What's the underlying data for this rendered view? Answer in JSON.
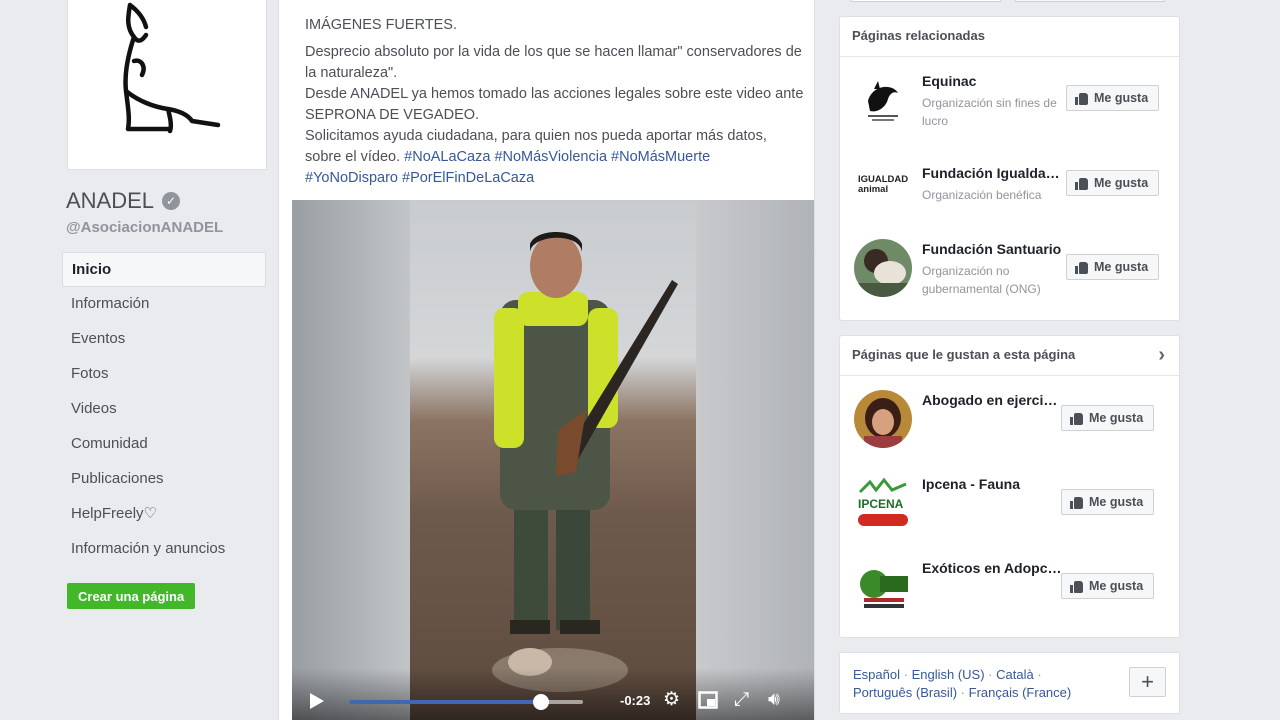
{
  "page": {
    "name": "ANADEL",
    "handle": "@AsociacionANADEL"
  },
  "nav": {
    "items": [
      {
        "label": "Inicio",
        "active": true
      },
      {
        "label": "Información",
        "active": false
      },
      {
        "label": "Eventos",
        "active": false
      },
      {
        "label": "Fotos",
        "active": false
      },
      {
        "label": "Videos",
        "active": false
      },
      {
        "label": "Comunidad",
        "active": false
      },
      {
        "label": "Publicaciones",
        "active": false
      },
      {
        "label": "HelpFreely♡",
        "active": false
      },
      {
        "label": "Información y anuncios",
        "active": false
      }
    ],
    "create_page": "Crear una página"
  },
  "post": {
    "line1": "IMÁGENES FUERTES.",
    "line2": "Desprecio absoluto por la vida de los que se hacen llamar\" conservadores de la naturaleza\".",
    "line3": "Desde ANADEL ya hemos tomado las acciones legales sobre este video ante SEPRONA DE VEGADEO.",
    "line4": "Solicitamos ayuda ciudadana, para quien nos pueda aportar más datos, sobre el vídeo.",
    "hashtags": [
      "#NoALaCaza",
      "#NoMásViolencia",
      "#NoMásMuerte",
      "#YoNoDisparo",
      "#PorElFinDeLaCaza"
    ]
  },
  "video": {
    "time_remaining": "-0:23",
    "progress": 0.82
  },
  "related_pages": {
    "title": "Páginas relacionadas",
    "items": [
      {
        "name": "Equinac",
        "category": "Organización sin fines de lucro",
        "like": "Me gusta"
      },
      {
        "name": "Fundación Igualdad Animal",
        "category": "Organización benéfica",
        "like": "Me gusta",
        "logo_text": "IGUALDAD animal"
      },
      {
        "name": "Fundación Santuario",
        "category": "Organización no gubernamental (ONG)",
        "like": "Me gusta"
      }
    ]
  },
  "liked_pages": {
    "title": "Páginas que le gustan a esta página",
    "items": [
      {
        "name": "Abogado en ejercicio",
        "like": "Me gusta"
      },
      {
        "name": "Ipcena - Fauna",
        "like": "Me gusta",
        "logo_text": "IPCENA"
      },
      {
        "name": "Exóticos en Adopción",
        "like": "Me gusta"
      }
    ]
  },
  "languages": {
    "items": [
      "Español",
      "English (US)",
      "Català",
      "Português (Brasil)",
      "Français (France)"
    ],
    "separator": "·",
    "add": "+"
  },
  "colors": {
    "background": "#e9ebee",
    "link": "#365899",
    "create_button": "#42b72a",
    "progress": "#4267b2"
  }
}
